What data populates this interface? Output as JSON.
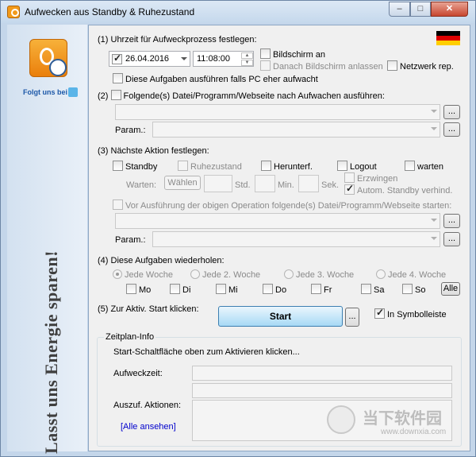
{
  "window": {
    "title": "Aufwecken aus Standby & Ruhezustand",
    "minimize_glyph": "–",
    "maximize_glyph": "□",
    "close_glyph": "✕"
  },
  "left_panel": {
    "follow_text": "Folgt uns bei",
    "slogan": "Lasst uns Energie sparen!",
    "logo_icon": "power-clock-icon",
    "social_icon": "twitter-icon"
  },
  "flag_colors": [
    "#000000",
    "#dd0000",
    "#ffce00"
  ],
  "section1": {
    "heading": "(1) Uhrzeit für Aufweckprozess festlegen:",
    "date_value": "26.04.2016",
    "time_value": "11:08:00",
    "bildschirm_an": "Bildschirm an",
    "danach_bildschirm": "Danach Bildschirm anlassen",
    "netzwerk": "Netzwerk rep.",
    "eher_aufwacht": "Diese Aufgaben ausführen falls PC eher aufwacht"
  },
  "section2": {
    "heading": "Folgende(s) Datei/Programm/Webseite nach Aufwachen ausführen:",
    "prefix": "(2)",
    "param_label": "Param.:",
    "browse_label": "..."
  },
  "section3": {
    "heading": "(3) Nächste Aktion festlegen:",
    "standby": "Standby",
    "ruhezustand": "Ruhezustand",
    "herunterf": "Herunterf.",
    "logout": "Logout",
    "warten": "warten",
    "warten_label": "Warten:",
    "waehlen": "Wählen",
    "std": "Std.",
    "min": "Min.",
    "sek": "Sek.",
    "erzwingen": "Erzwingen",
    "autom_standby": "Autom. Standby verhind.",
    "vor_ausfuehrung": "Vor Ausführung der obigen Operation folgende(s) Datei/Programm/Webseite starten:",
    "param_label": "Param.:",
    "browse_label": "..."
  },
  "section4": {
    "heading": "(4) Diese Aufgaben wiederholen:",
    "weeks": [
      "Jede Woche",
      "Jede 2. Woche",
      "Jede 3. Woche",
      "Jede 4. Woche"
    ],
    "days": [
      "Mo",
      "Di",
      "Mi",
      "Do",
      "Fr",
      "Sa",
      "So"
    ],
    "alle_button": "Alle"
  },
  "section5": {
    "heading": "(5) Zur Aktiv. Start klicken:",
    "start_button": "Start",
    "more_button": "...",
    "symbolleiste": "In Symbolleiste"
  },
  "zeitplan": {
    "title": "Zeitplan-Info",
    "message": "Start-Schaltfläche oben zum Aktivieren klicken...",
    "aufweckzeit_label": "Aufweckzeit:",
    "auszuf_label": "Auszuf. Aktionen:",
    "alle_ansehen": "[Alle ansehen]"
  },
  "watermark": {
    "text": "当下软件园",
    "url": "www.downxia.com"
  }
}
